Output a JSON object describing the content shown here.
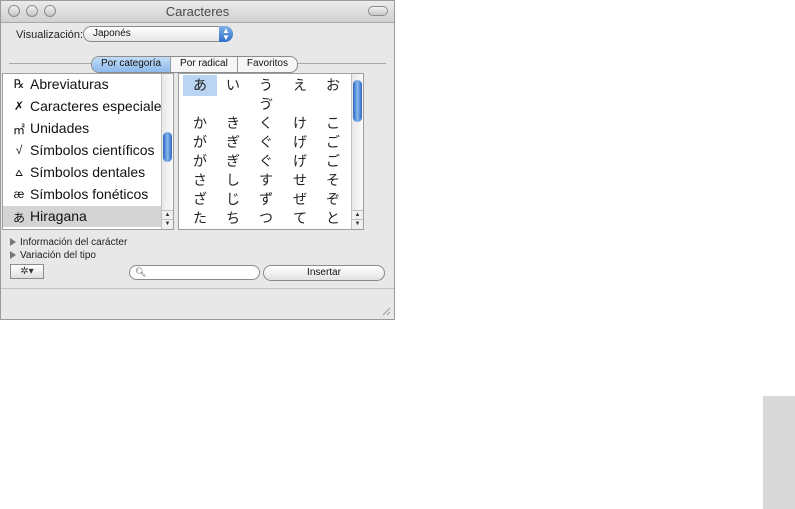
{
  "window": {
    "title": "Caracteres"
  },
  "toolbar": {
    "view_label": "Visualización:",
    "view_value": "Japonés",
    "tabs": [
      {
        "label": "Por categoría",
        "selected": true
      },
      {
        "label": "Por radical",
        "selected": false
      },
      {
        "label": "Favoritos",
        "selected": false
      }
    ]
  },
  "categories": [
    {
      "icon": "℞",
      "label": "Abreviaturas"
    },
    {
      "icon": "✗",
      "label": "Caracteres especiales"
    },
    {
      "icon": "㎡",
      "label": "Unidades"
    },
    {
      "icon": "√",
      "label": "Símbolos científicos"
    },
    {
      "icon": "⩟",
      "label": "Símbolos dentales"
    },
    {
      "icon": "æ",
      "label": "Símbolos fonéticos"
    },
    {
      "icon": "あ",
      "label": "Hiragana",
      "selected": true
    }
  ],
  "characters": [
    [
      "あ",
      "い",
      "う",
      "え",
      "お"
    ],
    [
      "",
      "",
      "ゔ",
      "",
      ""
    ],
    [
      "か",
      "き",
      "く",
      "け",
      "こ"
    ],
    [
      "が",
      "ぎ",
      "ぐ",
      "げ",
      "ご"
    ],
    [
      "が",
      "ぎ",
      "ぐ",
      "げ",
      "ご"
    ],
    [
      "さ",
      "し",
      "す",
      "せ",
      "そ"
    ],
    [
      "ざ",
      "じ",
      "ず",
      "ぜ",
      "ぞ"
    ],
    [
      "た",
      "ち",
      "つ",
      "て",
      "と"
    ]
  ],
  "disclosures": {
    "info": "Información del carácter",
    "variation": "Variación del tipo"
  },
  "footer": {
    "search_value": "",
    "insert_label": "Insertar"
  },
  "icons": {
    "action": "gear-icon",
    "search": "magnifier-icon"
  },
  "colors": {
    "selection": "#b9d5f3",
    "scroll_thumb": "#2a67c2",
    "window_bg": "#e8e8e8"
  }
}
